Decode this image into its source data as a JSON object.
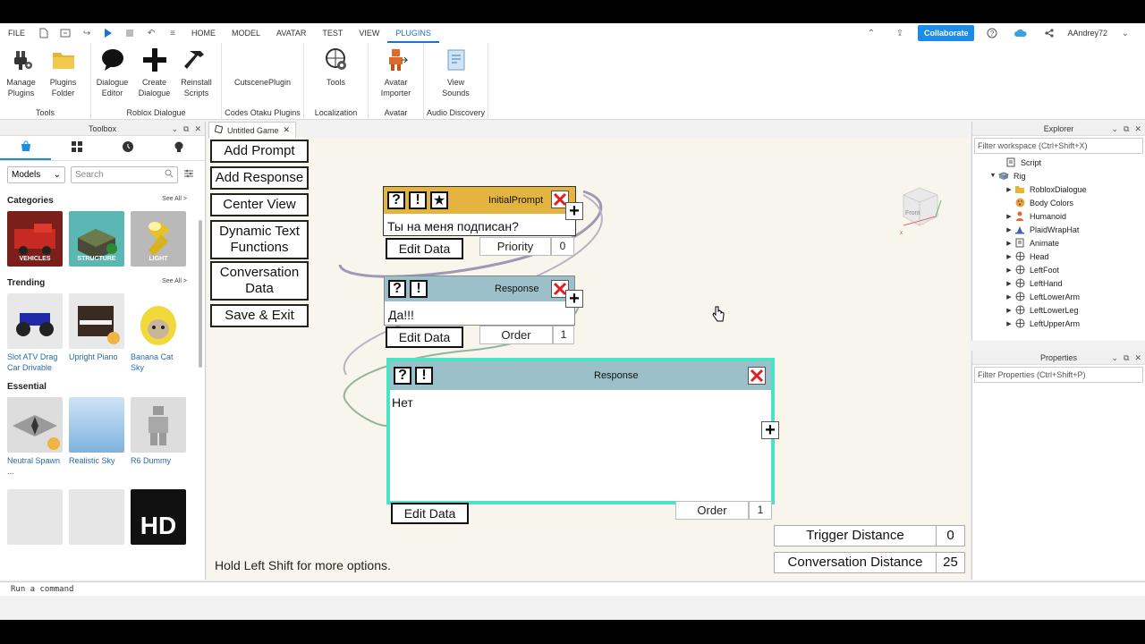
{
  "menubar": {
    "file": "FILE",
    "tabs": [
      "HOME",
      "MODEL",
      "AVATAR",
      "TEST",
      "VIEW",
      "PLUGINS"
    ],
    "active_tab": "PLUGINS",
    "collaborate": "Collaborate",
    "user": "AAndrey72"
  },
  "ribbon": {
    "groups": [
      {
        "label": "Tools",
        "buttons": [
          "Manage Plugins",
          "Plugins Folder"
        ]
      },
      {
        "label": "Roblox Dialogue",
        "buttons": [
          "Dialogue Editor",
          "Create Dialogue",
          "Reinstall Scripts"
        ]
      },
      {
        "label": "Codes Otaku Plugins",
        "buttons": [
          "CutscenePlugin"
        ]
      },
      {
        "label": "Localization",
        "buttons": [
          "Tools"
        ]
      },
      {
        "label": "Avatar",
        "buttons": [
          "Avatar Importer"
        ]
      },
      {
        "label": "Audio Discovery",
        "buttons": [
          "View Sounds"
        ]
      }
    ]
  },
  "toolbox": {
    "title": "Toolbox",
    "category_select": "Models",
    "search_placeholder": "Search",
    "categories_heading": "Categories",
    "see_all": "See All >",
    "categories": [
      "VEHICLES",
      "STRUCTURE",
      "LIGHT"
    ],
    "trending_heading": "Trending",
    "trending": [
      "Slot ATV Drag Car Drivable",
      "Upright Piano",
      "Banana Cat Sky"
    ],
    "essential_heading": "Essential",
    "essential": [
      "Neutral Spawn ...",
      "Realistic Sky",
      "R6 Dummy"
    ]
  },
  "doc_tab": "Untitled Game",
  "editor": {
    "buttons": {
      "add_prompt": "Add Prompt",
      "add_response": "Add Response",
      "center_view": "Center View",
      "dynamic_text": "Dynamic Text Functions",
      "conversation_data": "Conversation Data",
      "save_exit": "Save & Exit"
    },
    "hint": "Hold Left Shift for more options.",
    "nodes": {
      "prompt": {
        "title": "InitialPrompt",
        "text": "Ты на меня подписан?",
        "edit": "Edit Data",
        "field_label": "Priority",
        "field_value": "0"
      },
      "response1": {
        "title": "Response",
        "text": "Да!!!",
        "edit": "Edit Data",
        "field_label": "Order",
        "field_value": "1"
      },
      "response2": {
        "title": "Response",
        "text": "Нет",
        "edit": "Edit Data",
        "field_label": "Order",
        "field_value": "1"
      }
    },
    "trigger_distance": {
      "label": "Trigger Distance",
      "value": "0"
    },
    "conversation_distance": {
      "label": "Conversation Distance",
      "value": "25"
    },
    "glyphs": {
      "question": "?",
      "exclaim": "!",
      "star": "★",
      "plus": "+"
    },
    "colors": {
      "prompt_header": "#e3b440",
      "response_header": "#9cc0c9",
      "selected_border": "#49e3c5",
      "link_prompt": "#9c98b5",
      "link_response": "#93b39c"
    }
  },
  "viewcube": {
    "front": "Front"
  },
  "explorer": {
    "title": "Explorer",
    "filter": "Filter workspace (Ctrl+Shift+X)",
    "items": [
      "Script",
      "Rig",
      "RobloxDialogue",
      "Body Colors",
      "Humanoid",
      "PlaidWrapHat",
      "Animate",
      "Head",
      "LeftFoot",
      "LeftHand",
      "LeftLowerArm",
      "LeftLowerLeg",
      "LeftUpperArm"
    ]
  },
  "properties": {
    "title": "Properties",
    "filter": "Filter Properties (Ctrl+Shift+P)"
  },
  "command_bar": {
    "placeholder": "Run a command"
  }
}
